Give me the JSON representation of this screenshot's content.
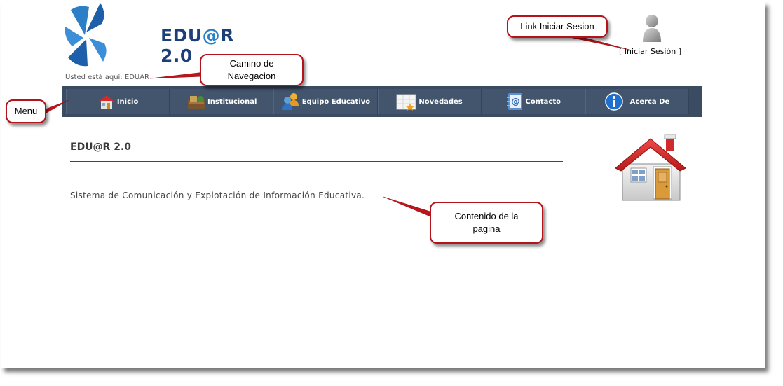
{
  "logo": {
    "text_prefix": "EDU",
    "text_at": "@",
    "text_suffix": "R 2.0"
  },
  "breadcrumb": {
    "label": "Usted está aquí:",
    "current": "EDUAR"
  },
  "login": {
    "open_bracket": "[",
    "link_label": "Iniciar Sesión",
    "close_bracket": "]"
  },
  "menu": {
    "items": [
      {
        "label": "Inicio",
        "icon": "home-icon"
      },
      {
        "label": "Institucional",
        "icon": "institution-icon"
      },
      {
        "label": "Equipo Educativo",
        "icon": "users-icon"
      },
      {
        "label": "Novedades",
        "icon": "calendar-icon"
      },
      {
        "label": "Contacto",
        "icon": "contact-book-icon"
      },
      {
        "label": "Acerca De",
        "icon": "info-icon"
      }
    ]
  },
  "content": {
    "title": "EDU@R 2.0",
    "text": "Sistema de Comunicación y Explotación de Información Educativa."
  },
  "annotations": {
    "menu": "Menu",
    "breadcrumb_line1": "Camino de",
    "breadcrumb_line2": "Navegacion",
    "login": "Link Iniciar Sesion",
    "content_line1": "Contenido de la",
    "content_line2": "pagina"
  },
  "colors": {
    "navbar": "#3a4b62",
    "callout_border": "#b3141c",
    "logo_text": "#1c3f78"
  }
}
